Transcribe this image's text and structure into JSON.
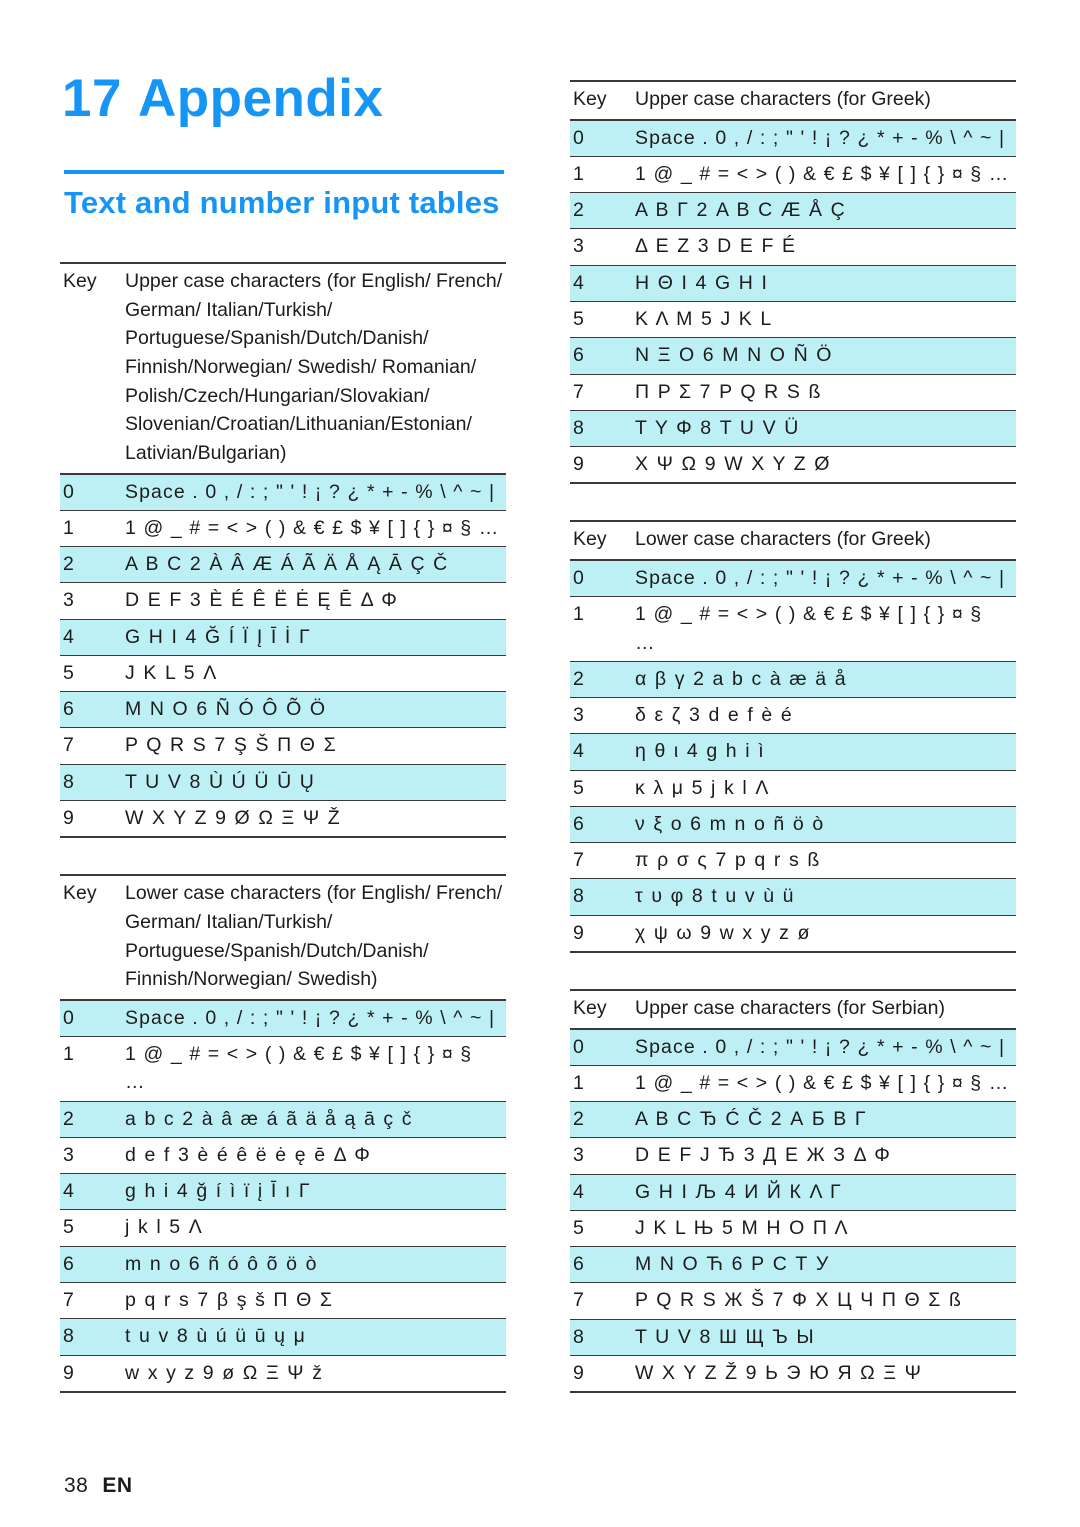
{
  "heading": {
    "chapter_number": "17",
    "chapter_title": "Appendix",
    "section_title": "Text and number input tables"
  },
  "footer": {
    "page_number": "38",
    "language_code": "EN"
  },
  "colors": {
    "accent": "#1795f5",
    "row_highlight": "#bdf0f4",
    "rule": "#3a3a3a",
    "text": "#1c1c1c"
  },
  "tables": [
    {
      "id": "upper-latin",
      "key_header": "Key",
      "value_header": "Upper case characters (for English/ French/ German/ Italian/Turkish/ Portuguese/Spanish/Dutch/Danish/ Finnish/Norwegian/ Swedish/ Romanian/ Polish/Czech/Hungarian/Slovakian/ Slovenian/Croatian/Lithuanian/Estonian/ Lativian/Bulgarian)",
      "rows": [
        {
          "key": "0",
          "value": "Space . 0 , / : ; \" ' ! ¡ ? ¿ * + - % \\ ^ ~ |"
        },
        {
          "key": "1",
          "value": "1 @ _ # = < > ( ) & € £ $ ¥ [ ] { } ¤ § …"
        },
        {
          "key": "2",
          "value": "A B C 2 À Â Æ Á Ã Ä Å Ą Ā Ç Č"
        },
        {
          "key": "3",
          "value": "D E F 3 È É Ê Ë Ė Ę Ē Δ Φ"
        },
        {
          "key": "4",
          "value": "G H I 4 Ğ Í Ï Į Ī İ Γ"
        },
        {
          "key": "5",
          "value": "J K L 5 Λ"
        },
        {
          "key": "6",
          "value": "M N O 6 Ñ Ó Ô Õ Ö"
        },
        {
          "key": "7",
          "value": "P Q R S 7 Ş Š Π Θ Σ"
        },
        {
          "key": "8",
          "value": "T U V 8 Ù Ú Ü Ū Ų"
        },
        {
          "key": "9",
          "value": "W X Y Z 9 Ø Ω Ξ Ψ Ž"
        }
      ]
    },
    {
      "id": "lower-latin",
      "key_header": "Key",
      "value_header": "Lower case characters (for English/ French/ German/ Italian/Turkish/ Portuguese/Spanish/Dutch/Danish/ Finnish/Norwegian/ Swedish)",
      "rows": [
        {
          "key": "0",
          "value": "Space . 0 , / : ; \" ' ! ¡ ? ¿ * + - % \\ ^ ~ |"
        },
        {
          "key": "1",
          "value": "1 @ _ # = < > ( ) & € £ $ ¥ [ ] { } ¤ §\n…"
        },
        {
          "key": "2",
          "value": "a b c 2 à â æ á ã ä å ą ā ç č"
        },
        {
          "key": "3",
          "value": "d e f 3 è é ê ë ė ę ē Δ Φ"
        },
        {
          "key": "4",
          "value": "g h i 4 ğ í ì ï į Ī ı Γ"
        },
        {
          "key": "5",
          "value": "j k l 5 Λ"
        },
        {
          "key": "6",
          "value": "m n o 6 ñ ó ô õ ö ò"
        },
        {
          "key": "7",
          "value": "p q r s 7 β ş š Π Θ Σ"
        },
        {
          "key": "8",
          "value": "t u v 8 ù ú ü ū ų μ"
        },
        {
          "key": "9",
          "value": "w x y z 9 ø Ω Ξ Ψ ž"
        }
      ]
    },
    {
      "id": "upper-greek",
      "key_header": "Key",
      "value_header": "Upper case characters (for Greek)",
      "rows": [
        {
          "key": "0",
          "value": "Space . 0 , / : ; \" ' ! ¡ ? ¿ * + - % \\ ^ ~ |"
        },
        {
          "key": "1",
          "value": "1 @ _ # = < > ( ) & € £ $ ¥ [ ] { } ¤ § …"
        },
        {
          "key": "2",
          "value": "Α Β Γ 2 A B C Æ Å Ç"
        },
        {
          "key": "3",
          "value": "Δ Ε Ζ 3 D E F É"
        },
        {
          "key": "4",
          "value": "Η Θ Ι 4 G H I"
        },
        {
          "key": "5",
          "value": "Κ Λ Μ 5 J K L"
        },
        {
          "key": "6",
          "value": "Ν Ξ Ο 6 M N O Ñ Ö"
        },
        {
          "key": "7",
          "value": "Π Ρ Σ 7 P Q R S ß"
        },
        {
          "key": "8",
          "value": "Τ Υ Φ 8 T U V Ü"
        },
        {
          "key": "9",
          "value": "Χ Ψ Ω 9 W X Y Z Ø"
        }
      ]
    },
    {
      "id": "lower-greek",
      "key_header": "Key",
      "value_header": "Lower case characters (for Greek)",
      "rows": [
        {
          "key": "0",
          "value": "Space . 0 , / : ; \" ' ! ¡ ? ¿ * + - % \\ ^ ~ |"
        },
        {
          "key": "1",
          "value": "1 @ _ # = < > ( ) & € £ $ ¥ [ ] { } ¤ §\n…"
        },
        {
          "key": "2",
          "value": "α β γ 2 a b c à æ ä å"
        },
        {
          "key": "3",
          "value": "δ ε ζ 3 d e f è é"
        },
        {
          "key": "4",
          "value": "η θ ι 4 g h i ì"
        },
        {
          "key": "5",
          "value": "κ λ μ 5 j k l Λ"
        },
        {
          "key": "6",
          "value": "ν ξ ο 6 m n o ñ ö ò"
        },
        {
          "key": "7",
          "value": "π ρ σ ς 7 p q r s ß"
        },
        {
          "key": "8",
          "value": "τ υ φ 8 t u v ù ü"
        },
        {
          "key": "9",
          "value": "χ ψ ω 9 w x y z ø"
        }
      ]
    },
    {
      "id": "upper-serbian",
      "key_header": "Key",
      "value_header": "Upper case characters (for Serbian)",
      "rows": [
        {
          "key": "0",
          "value": "Space . 0 , / : ; \" ' ! ¡ ? ¿ * + - % \\ ^ ~ |"
        },
        {
          "key": "1",
          "value": "1 @ _ # = < > ( ) & € £ $ ¥ [ ] { } ¤ § …"
        },
        {
          "key": "2",
          "value": "A B C Ђ Ć Č 2 А Б В Г"
        },
        {
          "key": "3",
          "value": "D E F J Ђ 3 Д Е Ж З Δ Φ"
        },
        {
          "key": "4",
          "value": "G H I Љ 4 И Й К Λ Γ"
        },
        {
          "key": "5",
          "value": "J K L Њ 5 М Н О Π Λ"
        },
        {
          "key": "6",
          "value": "M N O Ћ 6 Р С Т У"
        },
        {
          "key": "7",
          "value": "P Q R S Ж Š 7 Ф Х Ц Ч Π Θ Σ ß"
        },
        {
          "key": "8",
          "value": "T U V 8 Ш Щ Ъ Ы"
        },
        {
          "key": "9",
          "value": "W X Y Z Ž 9 Ь Э Ю Я Ω Ξ Ψ"
        }
      ]
    }
  ]
}
